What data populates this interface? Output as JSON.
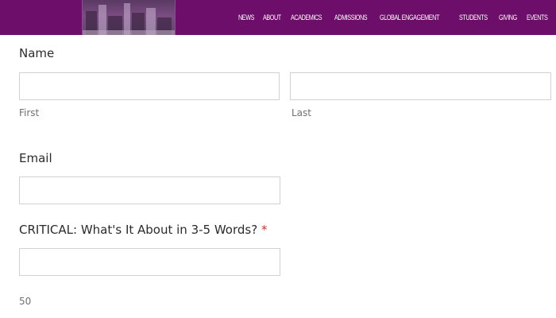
{
  "header": {
    "background_color": "#6d0e6a",
    "nav_items": [
      "NEWS",
      "ABOUT",
      "ACADEMICS",
      "ADMISSIONS",
      "GLOBAL ENGAGEMENT",
      "STUDENTS",
      "GIVING",
      "EVENTS"
    ]
  },
  "form": {
    "name_label": "Name",
    "first_placeholder": "",
    "first_value": "",
    "first_sublabel": "First",
    "last_value": "",
    "last_sublabel": "Last",
    "email_label": "Email",
    "email_value": "",
    "critical_label": "CRITICAL: What's It About in 3-5 Words?",
    "required_mark": "*",
    "critical_value": "",
    "char_counter": "50"
  }
}
